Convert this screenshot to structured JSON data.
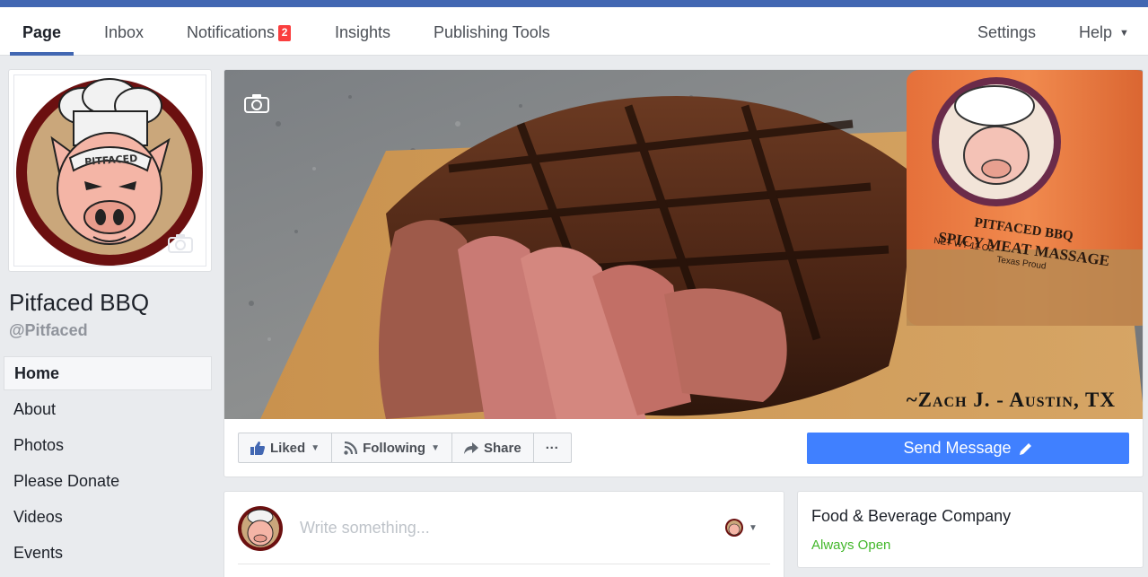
{
  "topnav": {
    "items": [
      {
        "label": "Page"
      },
      {
        "label": "Inbox"
      },
      {
        "label": "Notifications",
        "badge": "2"
      },
      {
        "label": "Insights"
      },
      {
        "label": "Publishing Tools"
      },
      {
        "label": "Settings"
      },
      {
        "label": "Help"
      }
    ]
  },
  "profile": {
    "logo_text": "PITFACED",
    "name": "Pitfaced BBQ",
    "handle": "@Pitfaced"
  },
  "sidebar": {
    "items": [
      {
        "label": "Home"
      },
      {
        "label": "About"
      },
      {
        "label": "Photos"
      },
      {
        "label": "Please Donate"
      },
      {
        "label": "Videos"
      },
      {
        "label": "Events"
      }
    ]
  },
  "cover": {
    "caption": "~Zach J. - Austin, TX",
    "bottle_brand": "PITFACED BBQ",
    "bottle_product": "SPICY MEAT MASSAGE",
    "bottle_weight": "NET WT 11 OZ",
    "bottle_tag": "Texas Proud"
  },
  "actions": {
    "liked": "Liked",
    "following": "Following",
    "share": "Share",
    "more": "···",
    "send_message": "Send Message"
  },
  "composer": {
    "placeholder": "Write something..."
  },
  "info": {
    "category": "Food & Beverage Company",
    "hours": "Always Open"
  },
  "colors": {
    "brand_blue": "#4267b2",
    "send_button": "#4080ff",
    "badge_red": "#fa3e3e",
    "open_green": "#42b72a"
  },
  "icons": [
    "camera-icon",
    "thumbs-up-icon",
    "rss-icon",
    "share-arrow-icon",
    "pencil-icon",
    "caret-down-icon"
  ]
}
